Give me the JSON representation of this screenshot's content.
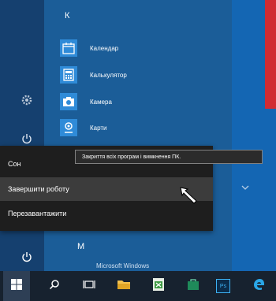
{
  "start_menu": {
    "groups": [
      {
        "letter": "К"
      },
      {
        "letter": "М",
        "partial_app": "Microsoft Windows"
      }
    ],
    "apps": [
      {
        "label": "Календар",
        "icon": "calendar-icon"
      },
      {
        "label": "Калькулятор",
        "icon": "calculator-icon"
      },
      {
        "label": "Камера",
        "icon": "camera-icon"
      },
      {
        "label": "Карти",
        "icon": "maps-icon"
      }
    ]
  },
  "power_menu": {
    "items": [
      {
        "label": "Сон"
      },
      {
        "label": "Завершити роботу"
      },
      {
        "label": "Перезавантажити"
      }
    ],
    "tooltip": "Закриття всіх програм і вимкнення ПК."
  },
  "taskbar": {
    "items": [
      "start-icon",
      "search-icon",
      "task-view-icon",
      "file-explorer-icon",
      "excel-icon",
      "store-icon",
      "photoshop-icon",
      "edge-icon"
    ],
    "photoshop_label": "Ps"
  },
  "colors": {
    "accent": "#1466b3",
    "tile_red": "#d12b33",
    "menu_bg": "#1e1e1e",
    "taskbar_bg": "#17222f"
  }
}
